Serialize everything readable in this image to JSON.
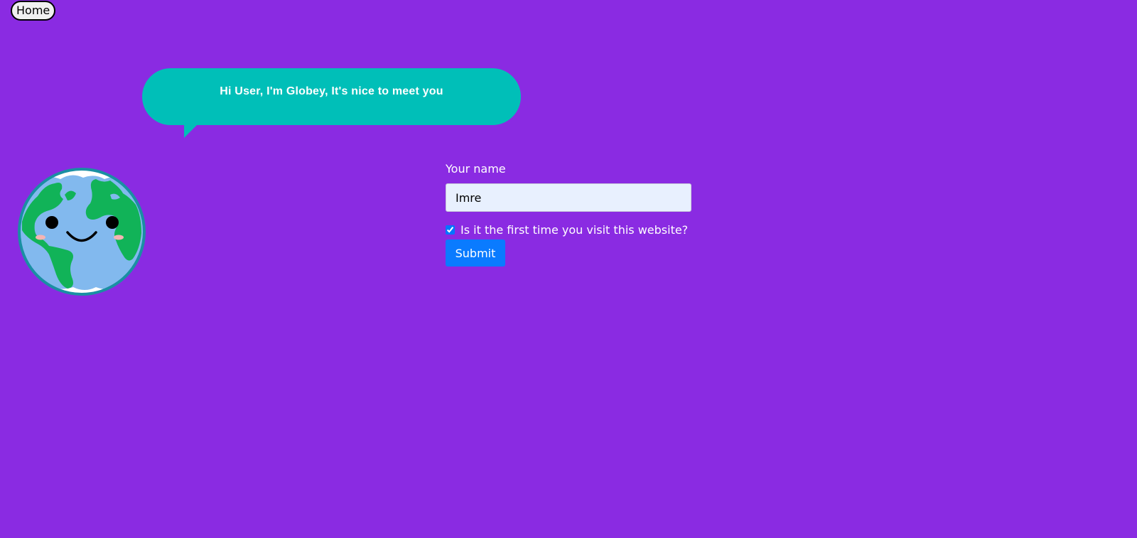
{
  "nav": {
    "home_label": "Home"
  },
  "mascot": {
    "greeting": "Hi User, I'm Globey, It's nice to meet you",
    "icon": "smiling-earth-globe-icon"
  },
  "form": {
    "name_label": "Your name",
    "name_value": "Imre",
    "first_visit_label": "Is it the first time you visit this website?",
    "first_visit_checked": true,
    "submit_label": "Submit"
  },
  "colors": {
    "background": "#8a2be2",
    "bubble": "#00bfb8",
    "submit": "#0a7bff",
    "input_bg": "#e8f0fe"
  }
}
